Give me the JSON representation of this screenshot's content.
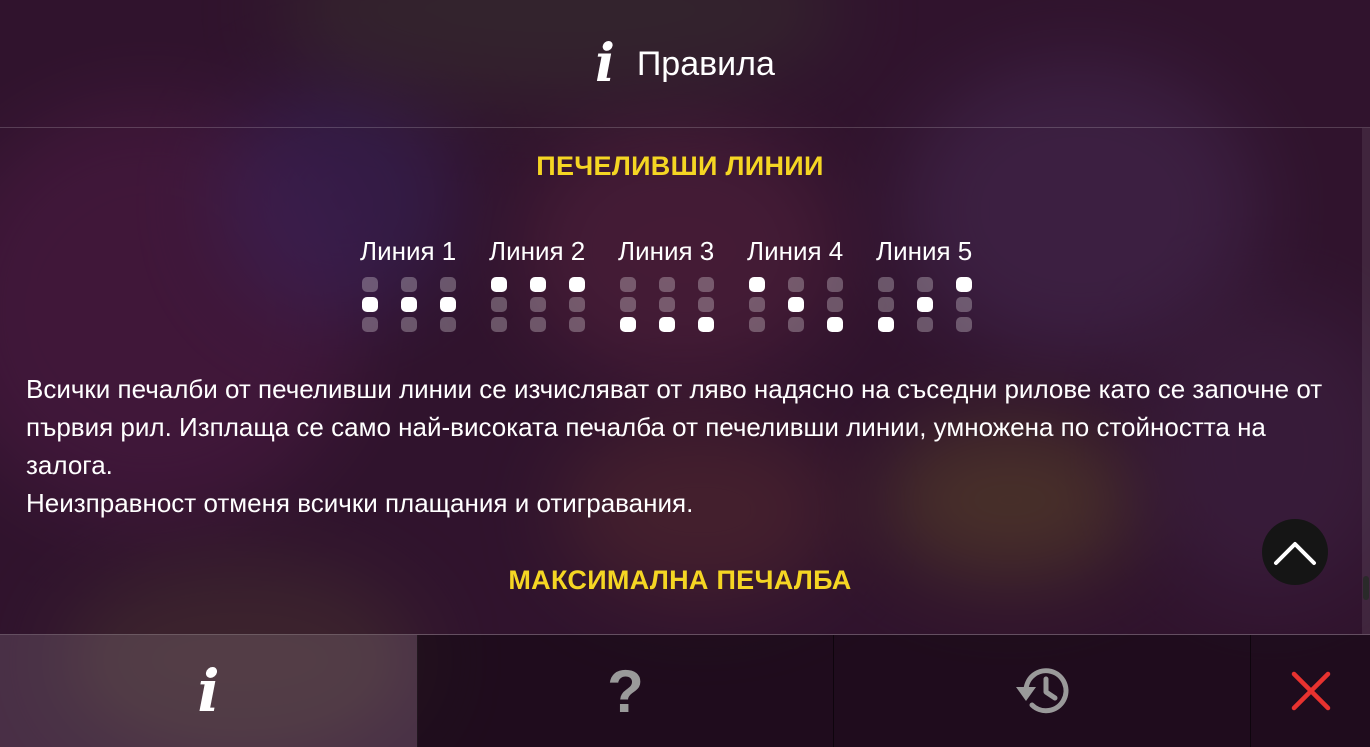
{
  "header": {
    "icon": "info-icon",
    "title": "Правила"
  },
  "content": {
    "winning_lines_heading": "ПЕЧЕЛИВШИ ЛИНИИ",
    "paylines": [
      {
        "label": "Линия 1",
        "active_row_per_reel": [
          2,
          2,
          2
        ]
      },
      {
        "label": "Линия 2",
        "active_row_per_reel": [
          1,
          1,
          1
        ]
      },
      {
        "label": "Линия 3",
        "active_row_per_reel": [
          3,
          3,
          3
        ]
      },
      {
        "label": "Линия 4",
        "active_row_per_reel": [
          1,
          2,
          3
        ]
      },
      {
        "label": "Линия 5",
        "active_row_per_reel": [
          3,
          2,
          1
        ]
      }
    ],
    "rules_paragraph_1": "Всички печалби от печеливши линии се изчисляват от ляво надясно на съседни рилове като се започне от първия рил. Изплаща се само най-високата печалба от печеливши линии, умножена по стойността на залога.",
    "rules_paragraph_2": "Неизправност отменя всички плащания и отигравания.",
    "max_win_heading": "МАКСИМАЛНА ПЕЧАЛБА"
  },
  "scroll": {
    "up_button_icon": "chevron-up-icon"
  },
  "bottom_bar": {
    "info_icon": "info-icon",
    "info_glyph": "i",
    "help_icon": "question-icon",
    "help_glyph": "?",
    "history_icon": "history-icon",
    "close_icon": "close-icon"
  },
  "colors": {
    "heading": "#f5d623",
    "close": "#e8322f",
    "text": "#ffffff"
  }
}
